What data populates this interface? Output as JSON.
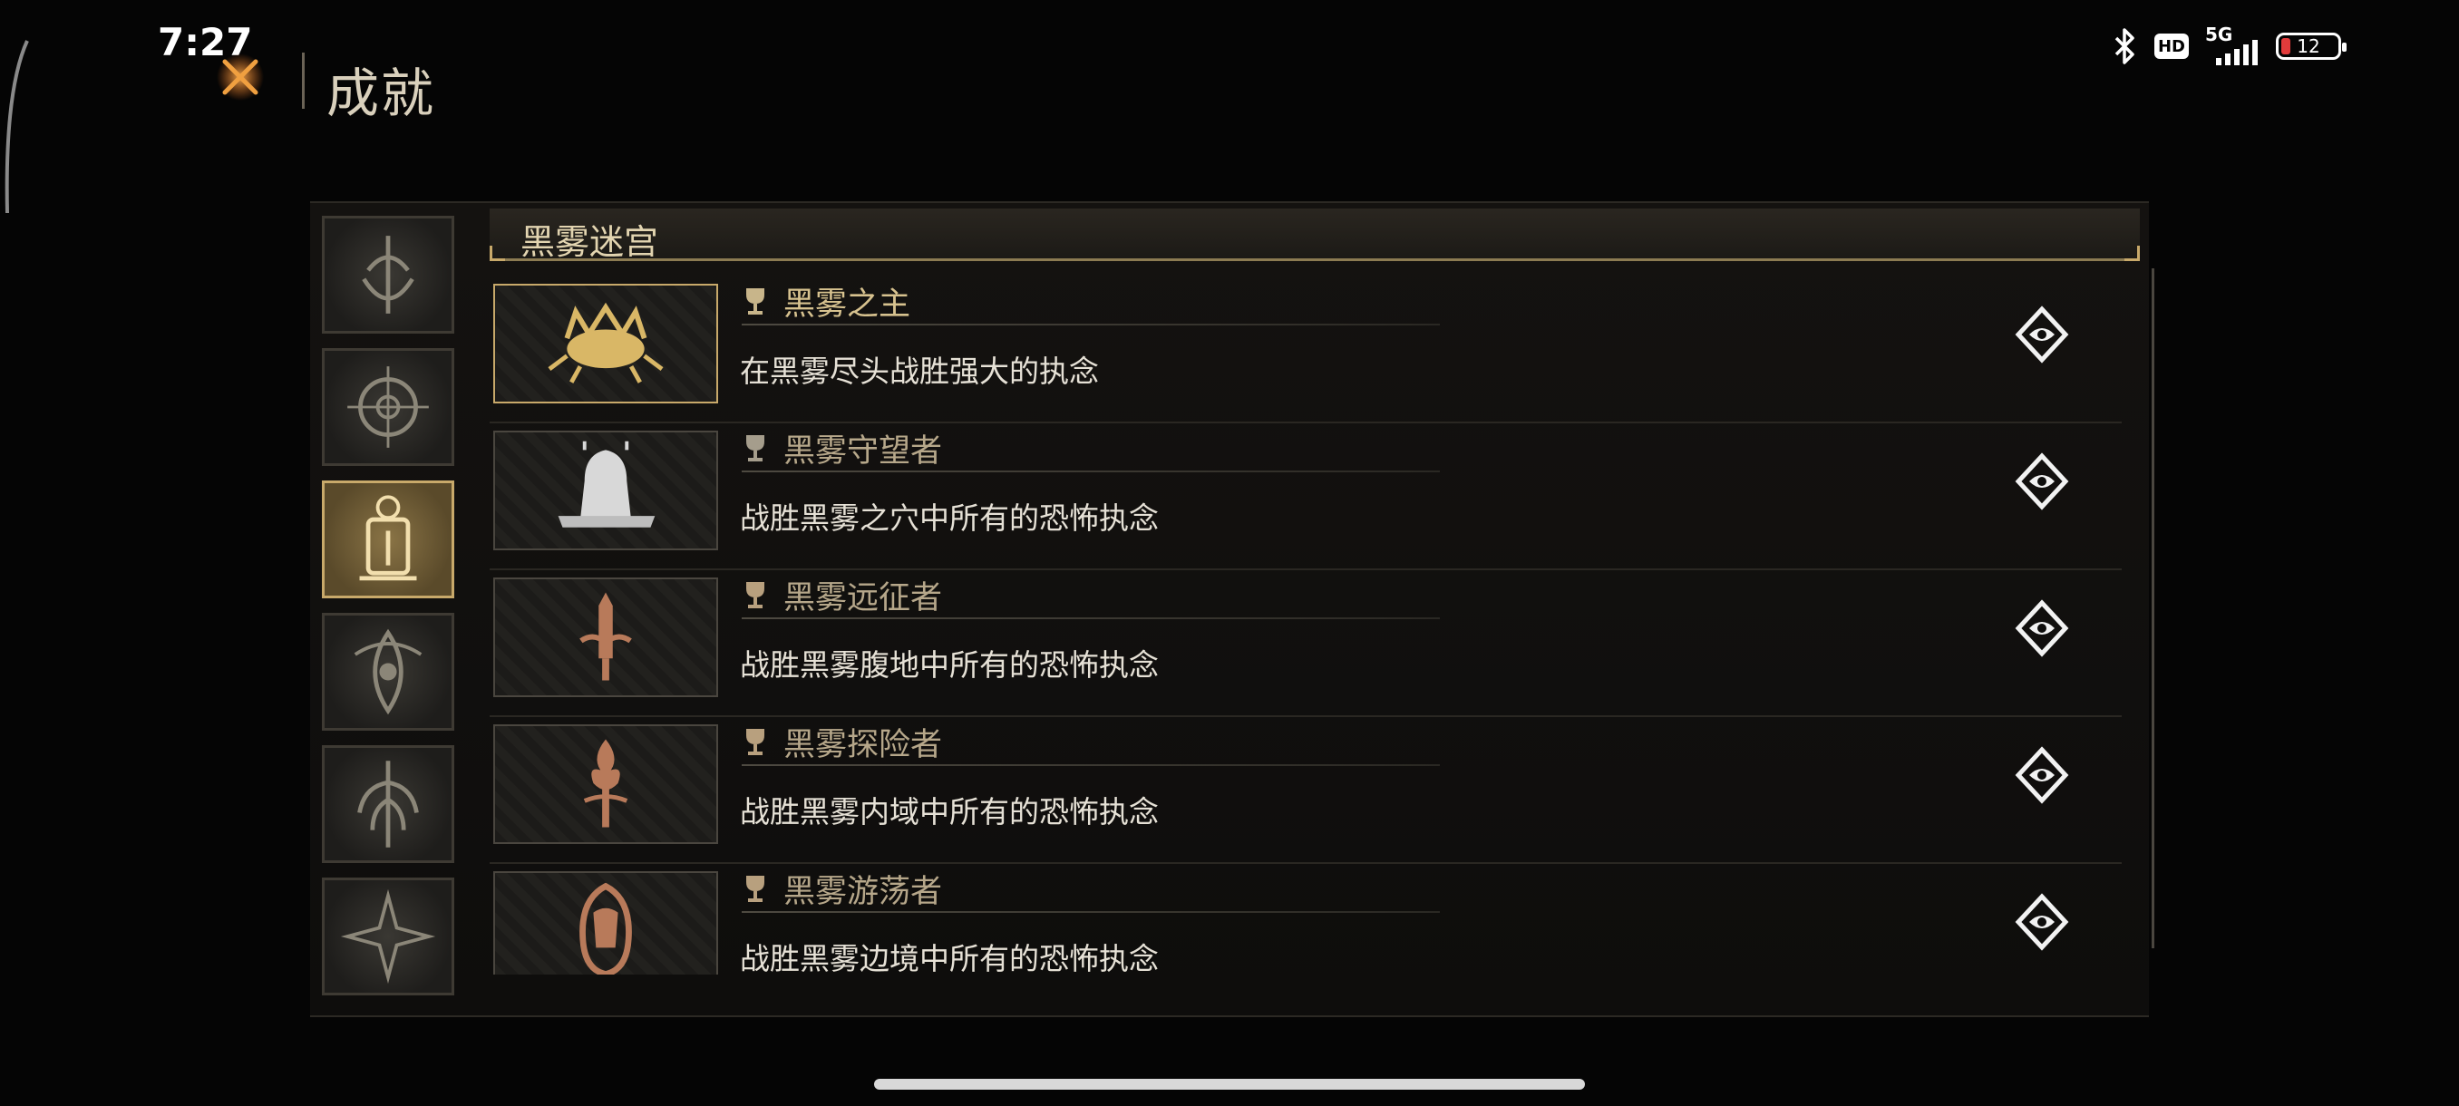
{
  "status_bar": {
    "time": "7:27",
    "hd_label": "HD",
    "network": "5G",
    "battery_level": "12"
  },
  "header": {
    "title": "成就"
  },
  "section": {
    "title": "黑雾迷宫"
  },
  "side_tabs": [
    {
      "name": "category-tab-1",
      "active": false
    },
    {
      "name": "category-tab-2",
      "active": false
    },
    {
      "name": "category-tab-3",
      "active": true
    },
    {
      "name": "category-tab-4",
      "active": false
    },
    {
      "name": "category-tab-5",
      "active": false
    },
    {
      "name": "category-tab-6",
      "active": false
    }
  ],
  "achievements": [
    {
      "name": "黑雾之主",
      "description": "在黑雾尽头战胜强大的执念",
      "unlocked": true,
      "icon": "crab-crown-icon"
    },
    {
      "name": "黑雾守望者",
      "description": "战胜黑雾之穴中所有的恐怖执念",
      "unlocked": false,
      "icon": "hooded-figure-icon"
    },
    {
      "name": "黑雾远征者",
      "description": "战胜黑雾腹地中所有的恐怖执念",
      "unlocked": false,
      "icon": "sword-icon"
    },
    {
      "name": "黑雾探险者",
      "description": "战胜黑雾内域中所有的恐怖执念",
      "unlocked": false,
      "icon": "torch-icon"
    },
    {
      "name": "黑雾游荡者",
      "description": "战胜黑雾边境中所有的恐怖执念",
      "unlocked": false,
      "icon": "cloak-icon"
    }
  ],
  "colors": {
    "gold_accent": "#c8a96a",
    "background": "#050505",
    "bronze": "#b87a5a"
  }
}
